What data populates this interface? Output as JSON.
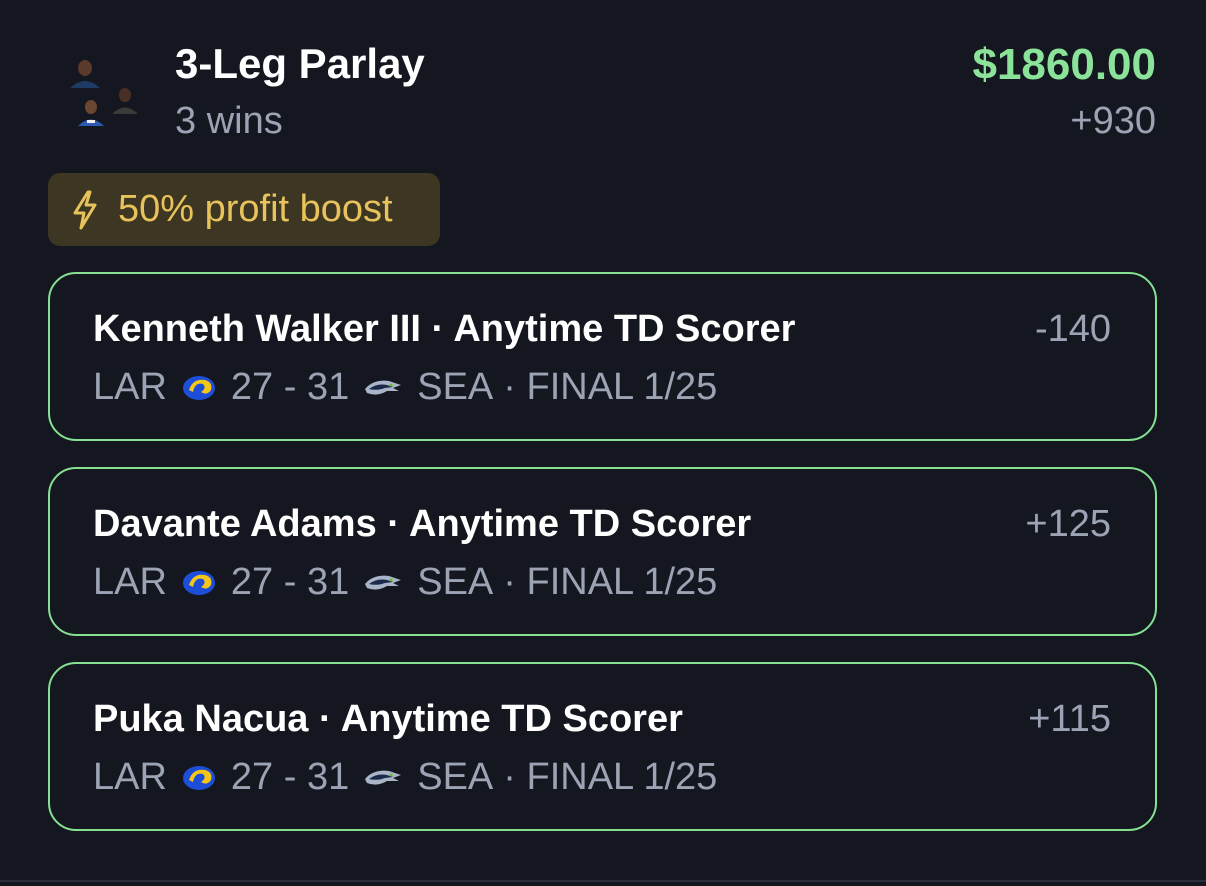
{
  "parlay": {
    "title": "3-Leg Parlay",
    "subtitle": "3 wins",
    "payout": "$1860.00",
    "odds": "+930",
    "boost_label": "50% profit boost"
  },
  "legs": [
    {
      "title": "Kenneth Walker III · Anytime TD Scorer",
      "odds": "-140",
      "away_team": "LAR",
      "score": "27 - 31",
      "home_team": "SEA",
      "status": "· FINAL 1/25"
    },
    {
      "title": "Davante Adams · Anytime TD Scorer",
      "odds": "+125",
      "away_team": "LAR",
      "score": "27 - 31",
      "home_team": "SEA",
      "status": "· FINAL 1/25"
    },
    {
      "title": "Puka Nacua · Anytime TD Scorer",
      "odds": "+115",
      "away_team": "LAR",
      "score": "27 - 31",
      "home_team": "SEA",
      "status": "· FINAL 1/25"
    }
  ],
  "colors": {
    "background": "#14171f",
    "win_green": "#8be39a",
    "leg_border": "#86e091",
    "muted_text": "#9ca3b4",
    "boost_bg": "#3d3622",
    "boost_text": "#e8c25a"
  },
  "icons": {
    "boost": "lightning-bolt-icon",
    "away_logo": "rams-logo",
    "home_logo": "seahawks-logo"
  }
}
